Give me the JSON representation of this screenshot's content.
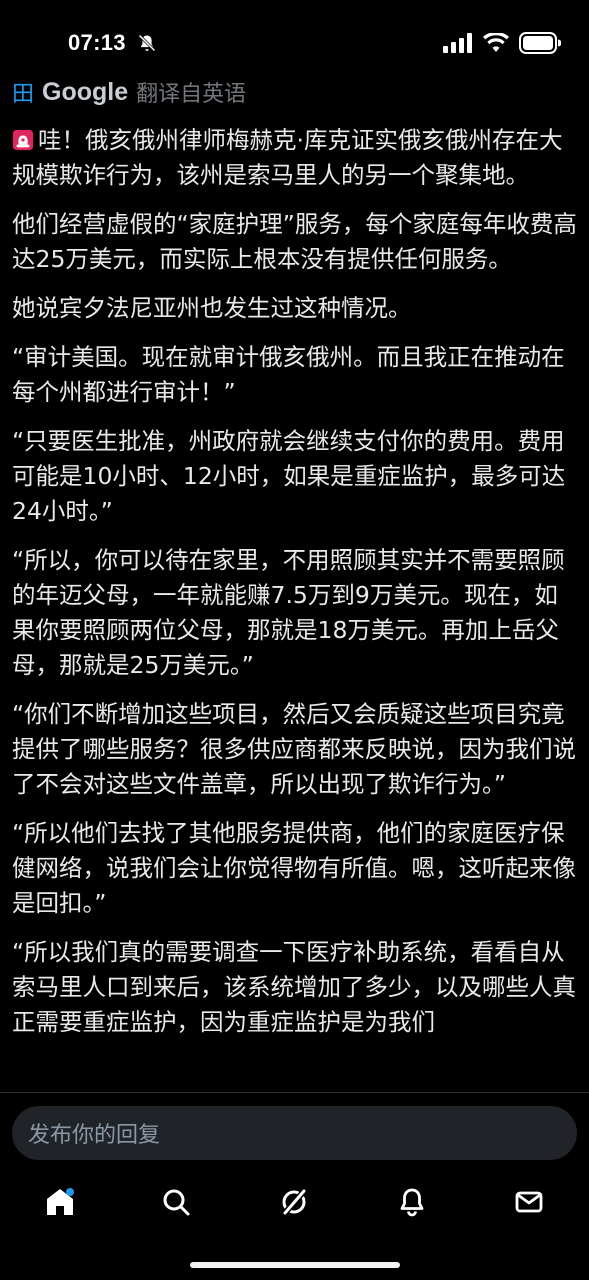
{
  "status_bar": {
    "time": "07:13"
  },
  "translation": {
    "google_label": "Google",
    "prefix_glyph": "田",
    "translated_label": "翻译自英语"
  },
  "tweet": {
    "paragraphs": [
      "哇！俄亥俄州律师梅赫克·库克证实俄亥俄州存在大规模欺诈行为，该州是索马里人的另一个聚集地。",
      "他们经营虚假的“家庭护理”服务，每个家庭每年收费高达25万美元，而实际上根本没有提供任何服务。",
      "她说宾夕法尼亚州也发生过这种情况。",
      "“审计美国。现在就审计俄亥俄州。而且我正在推动在每个州都进行审计！”",
      "“只要医生批准，州政府就会继续支付你的费用。费用可能是10小时、12小时，如果是重症监护，最多可达24小时。”",
      "“所以，你可以待在家里，不用照顾其实并不需要照顾的年迈父母，一年就能赚7.5万到9万美元。现在，如果你要照顾两位父母，那就是18万美元。再加上岳父母，那就是25万美元。”",
      "“你们不断增加这些项目，然后又会质疑这些项目究竟提供了哪些服务？很多供应商都来反映说，因为我们说了不会对这些文件盖章，所以出现了欺诈行为。”",
      "“所以他们去找了其他服务提供商，他们的家庭医疗保健网络，说我们会让你觉得物有所值。嗯，这听起来像是回扣。”",
      "“所以我们真的需要调查一下医疗补助系统，看看自从索马里人口到来后，该系统增加了多少，以及哪些人真正需要重症监护，因为重症监护是为我们"
    ],
    "leading_icon": "rotating-light-icon"
  },
  "reply": {
    "placeholder": "发布你的回复"
  },
  "nav": {
    "items": [
      "home-icon",
      "search-icon",
      "grok-icon",
      "notifications-icon",
      "messages-icon"
    ]
  },
  "colors": {
    "background": "#000000",
    "text": "#e7e9ea",
    "accent": "#1d9bf0",
    "muted": "#71767b",
    "input_bg": "#202327"
  }
}
